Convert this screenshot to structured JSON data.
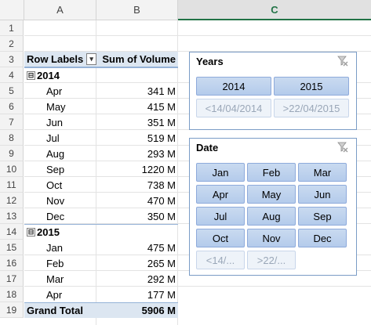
{
  "columns": [
    "A",
    "B",
    "C"
  ],
  "rows": [
    "1",
    "2",
    "3",
    "4",
    "5",
    "6",
    "7",
    "8",
    "9",
    "10",
    "11",
    "12",
    "13",
    "14",
    "15",
    "16",
    "17",
    "18",
    "19"
  ],
  "pivot": {
    "header": {
      "row_labels": "Row Labels",
      "sum_label": "Sum of Volume",
      "filter_icon": "sort-filter-icon"
    },
    "year_2014": {
      "label": "2014",
      "expander": "⊟",
      "months": [
        {
          "month": "Apr",
          "value": "341 M"
        },
        {
          "month": "May",
          "value": "415 M"
        },
        {
          "month": "Jun",
          "value": "351 M"
        },
        {
          "month": "Jul",
          "value": "519 M"
        },
        {
          "month": "Aug",
          "value": "293 M"
        },
        {
          "month": "Sep",
          "value": "1220 M"
        },
        {
          "month": "Oct",
          "value": "738 M"
        },
        {
          "month": "Nov",
          "value": "470 M"
        },
        {
          "month": "Dec",
          "value": "350 M"
        }
      ]
    },
    "year_2015": {
      "label": "2015",
      "expander": "⊟",
      "months": [
        {
          "month": "Jan",
          "value": "475 M"
        },
        {
          "month": "Feb",
          "value": "265 M"
        },
        {
          "month": "Mar",
          "value": "292 M"
        },
        {
          "month": "Apr",
          "value": "177 M"
        }
      ]
    },
    "grand_total": {
      "label": "Grand Total",
      "value": "5906 M"
    }
  },
  "slicer_years": {
    "title": "Years",
    "clear_icon": "clear-filter-icon",
    "buttons": [
      {
        "label": "2014",
        "state": "selected"
      },
      {
        "label": "2015",
        "state": "selected"
      },
      {
        "label": "<14/04/2014",
        "state": "nodata"
      },
      {
        "label": ">22/04/2015",
        "state": "nodata"
      }
    ]
  },
  "slicer_date": {
    "title": "Date",
    "clear_icon": "clear-filter-icon",
    "buttons": [
      {
        "label": "Jan",
        "state": "selected"
      },
      {
        "label": "Feb",
        "state": "selected"
      },
      {
        "label": "Mar",
        "state": "selected"
      },
      {
        "label": "Apr",
        "state": "selected"
      },
      {
        "label": "May",
        "state": "selected"
      },
      {
        "label": "Jun",
        "state": "selected"
      },
      {
        "label": "Jul",
        "state": "selected"
      },
      {
        "label": "Aug",
        "state": "selected"
      },
      {
        "label": "Sep",
        "state": "selected"
      },
      {
        "label": "Oct",
        "state": "selected"
      },
      {
        "label": "Nov",
        "state": "selected"
      },
      {
        "label": "Dec",
        "state": "selected"
      },
      {
        "label": "<14/...",
        "state": "nodata"
      },
      {
        "label": ">22/...",
        "state": "nodata"
      }
    ]
  },
  "colors": {
    "accent": "#217346",
    "pivot_header": "#dce6f1",
    "slicer_selected": "#b4cbeb",
    "slicer_border": "#7a9cc6"
  }
}
